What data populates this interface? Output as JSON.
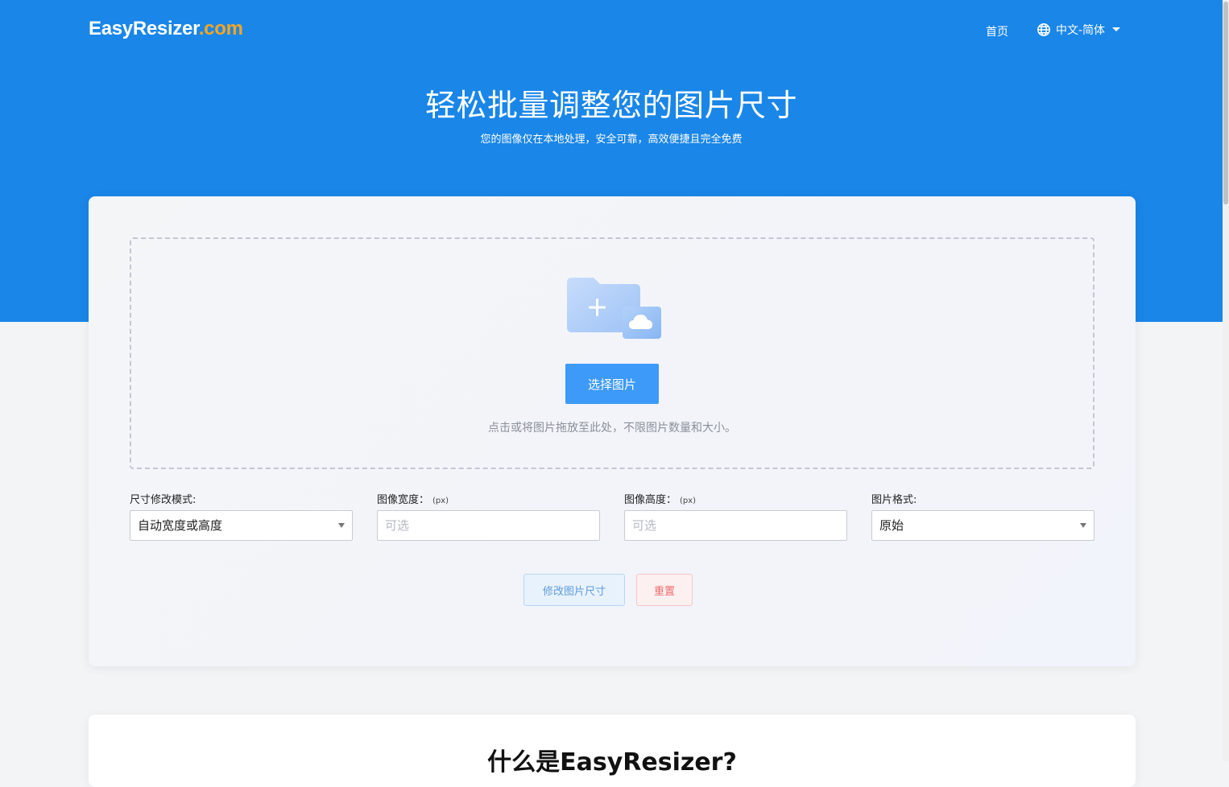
{
  "header": {
    "logo_main": "EasyResizer",
    "logo_accent": ".com",
    "nav_home": "首页",
    "language": "中文-简体"
  },
  "hero": {
    "title": "轻松批量调整您的图片尺寸",
    "subtitle": "您的图像仅在本地处理，安全可靠，高效便捷且完全免费"
  },
  "upload": {
    "button_label": "选择图片",
    "hint": "点击或将图片拖放至此处，不限图片数量和大小。"
  },
  "options": {
    "mode": {
      "label": "尺寸修改模式:",
      "value": "自动宽度或高度"
    },
    "width": {
      "label": "图像宽度：",
      "unit": "(px)",
      "placeholder": "可选"
    },
    "height": {
      "label": "图像高度：",
      "unit": "(px)",
      "placeholder": "可选"
    },
    "format": {
      "label": "图片格式:",
      "value": "原始"
    }
  },
  "actions": {
    "resize_label": "修改图片尺寸",
    "reset_label": "重置"
  },
  "section2": {
    "title": "什么是EasyResizer?"
  },
  "colors": {
    "hero_blue": "#1a86e8",
    "primary_button": "#3d9af8",
    "logo_accent": "#f5a623",
    "reset_red": "#ef6d6d"
  }
}
